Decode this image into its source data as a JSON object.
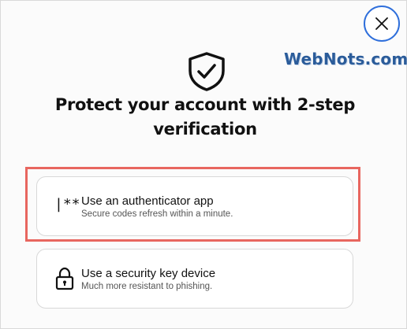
{
  "watermark": {
    "text": "WebNots.com"
  },
  "dialog": {
    "title": "Protect your account with 2-step verification",
    "close_icon": "close-icon",
    "shield_icon": "shield-check-icon"
  },
  "options": [
    {
      "icon": "password-icon",
      "icon_text": "|**",
      "title": "Use an authenticator app",
      "description": "Secure codes refresh within a minute.",
      "highlighted": true
    },
    {
      "icon": "lock-icon",
      "title": "Use a security key device",
      "description": "Much more resistant to phishing.",
      "highlighted": false
    }
  ],
  "colors": {
    "close_border": "#2f6fdb",
    "highlight_border": "#e8665f",
    "watermark": "#2b5c9a"
  }
}
